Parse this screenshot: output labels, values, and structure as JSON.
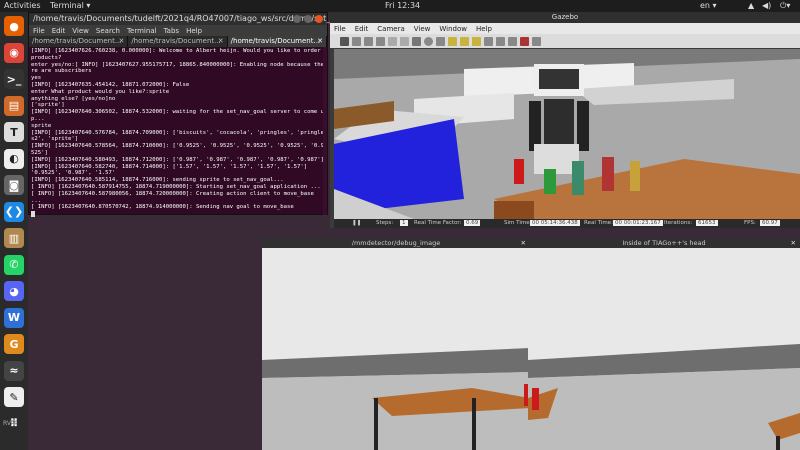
{
  "topbar": {
    "activities": "Activities",
    "app": "Terminal ▾",
    "clock": "Fri 12:34",
    "lang": "en ▾"
  },
  "dock": [
    {
      "name": "firefox-icon",
      "color": "#e66000",
      "glyph": "●"
    },
    {
      "name": "chrome-icon",
      "color": "#db4437",
      "glyph": "◉"
    },
    {
      "name": "terminal-icon",
      "color": "#333",
      "glyph": ">_"
    },
    {
      "name": "files-icon",
      "color": "#cf6a2a",
      "glyph": "▤"
    },
    {
      "name": "typora-icon",
      "color": "#ddd",
      "glyph": "T"
    },
    {
      "name": "okular-icon",
      "color": "#eee",
      "glyph": "◐"
    },
    {
      "name": "screenshot-icon",
      "color": "#666",
      "glyph": "◙"
    },
    {
      "name": "vscode-icon",
      "color": "#1e88e5",
      "glyph": "❮❯"
    },
    {
      "name": "archive-icon",
      "color": "#b08850",
      "glyph": "▥"
    },
    {
      "name": "whatsapp-icon",
      "color": "#25d366",
      "glyph": "✆"
    },
    {
      "name": "discord-icon",
      "color": "#5865f2",
      "glyph": "◕"
    },
    {
      "name": "vpn-icon",
      "color": "#2f6fd8",
      "glyph": "W"
    },
    {
      "name": "ubuntu-software-icon",
      "color": "#e08a1e",
      "glyph": "G"
    },
    {
      "name": "system-monitor-icon",
      "color": "#444",
      "glyph": "≈"
    },
    {
      "name": "text-editor-icon",
      "color": "#eee",
      "glyph": "✎"
    },
    {
      "name": "show-apps-icon",
      "color": "#2b2b2b",
      "glyph": "⠿"
    }
  ],
  "dock_footer": "RVIZ",
  "terminal": {
    "title": "/home/travis/Documents/tudelft/2021q4/RO47007/tiago_ws/src/demo/set_nav_goal/lau...",
    "menu": [
      "File",
      "Edit",
      "View",
      "Search",
      "Terminal",
      "Tabs",
      "Help"
    ],
    "tabs": [
      "/home/travis/Document...",
      "/home/travis/Document...",
      "/home/travis/Document..."
    ],
    "lines": [
      "[INFO] [1623407626.760238, 0.000000]: Welcome to Albert heijn. Would you like to order products?",
      "enter yes/no:[ INFO] [1623407627.955175717, 18865.840000000]: Enabling node because there are subscribers",
      "yes",
      "[INFO] [1623407635.454142, 18871.072000]: False",
      "enter What product would you like?:sprite",
      "anything else? [yes/no]no",
      "['sprite']",
      "[INFO] [1623407640.306502, 18874.532000]: waiting for the set_nav_goal server to come up...",
      "sprite",
      "[INFO] [1623407640.576784, 18874.709000]: ['biscuits', 'cocacola', 'pringles', 'pringles2', 'sprite']",
      "[INFO] [1623407640.578564, 18874.710000]: ['0.9525', '0.9525', '0.9525', '0.9525', '0.9525']",
      "[INFO] [1623407640.580493, 18874.712000]: ['0.987', '0.987', '0.987', '0.987', '0.987']",
      "[INFO] [1623407640.582740, 18874.714000]: ['1.57', '1.57', '1.57', '1.57', '1.57']",
      "'0.9525', '0.987', '1.57'",
      "[INFO] [1623407640.585114, 18874.716000]: sending sprite to set_nav_goal...",
      "[ INFO] [1623407640.587914755, 18874.719000000]: Starting set_nav_goal application ...",
      "[ INFO] [1623407640.587980056, 18874.720000000]: Creating action client to move_base ...",
      "[ INFO] [1623407640.870570742, 18874.914000000]: Sending nav goal to move_base"
    ]
  },
  "gazebo": {
    "title": "Gazebo",
    "menu": [
      "File",
      "Edit",
      "Camera",
      "View",
      "Window",
      "Help"
    ],
    "status": {
      "steps_label": "Steps:",
      "steps_value": "1",
      "rtf_label": "Real Time Factor:",
      "rtf_value": "0.69",
      "simtime_label": "Sim Time:",
      "simtime_value": "00 05:14:36.438",
      "realtime_label": "Real Time:",
      "realtime_value": "00 00:01:23.167",
      "iter_label": "Iterations:",
      "iter_value": "61653",
      "fps_label": "FPS:",
      "fps_value": "60.97"
    }
  },
  "cam1": {
    "title": "/mmdetector/debug_image"
  },
  "cam2": {
    "title": "Inside of TIAGo++'s head"
  }
}
